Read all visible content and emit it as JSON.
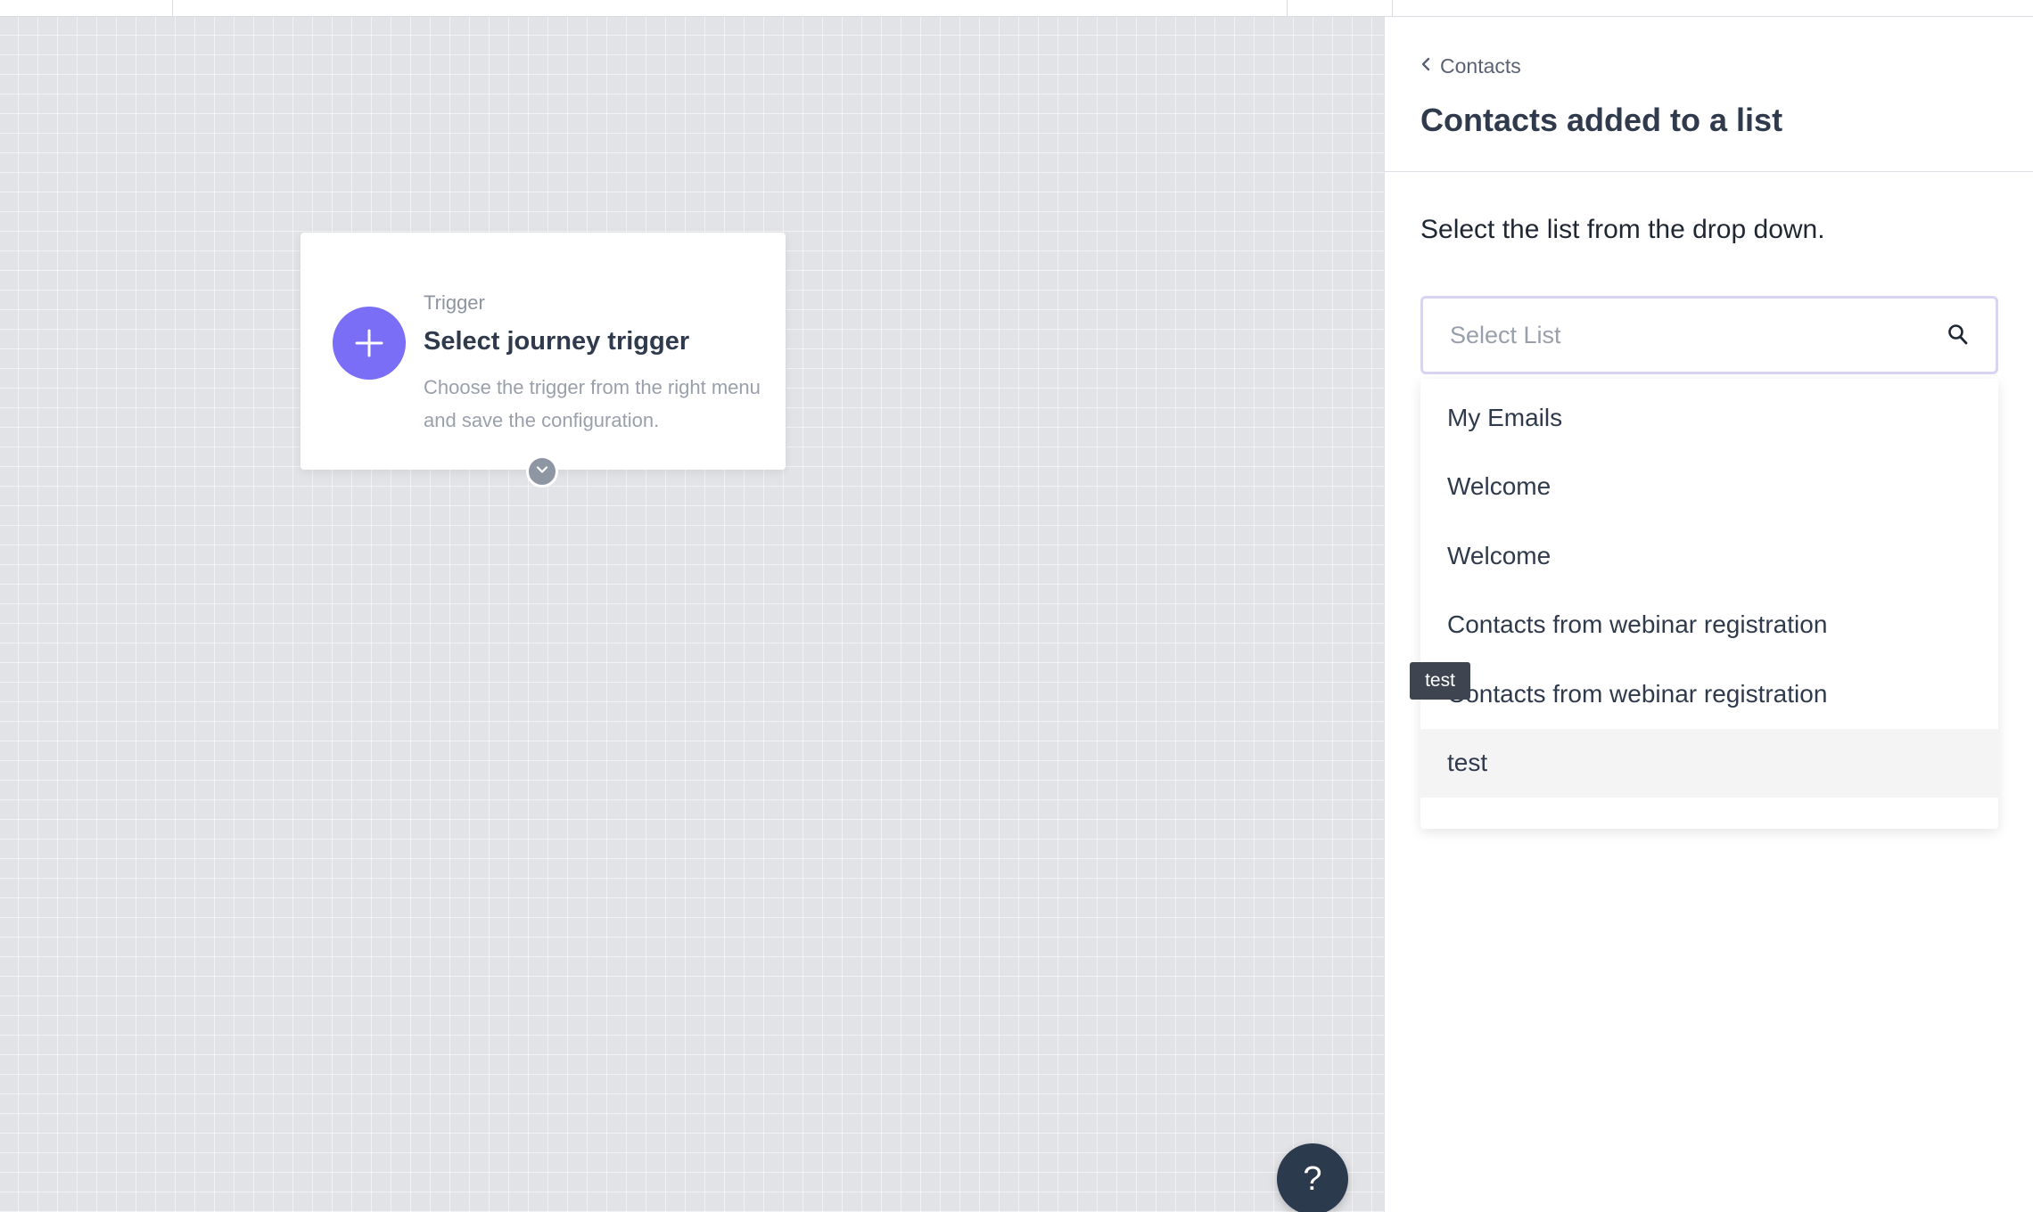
{
  "canvas": {
    "trigger_card": {
      "kicker": "Trigger",
      "title": "Select journey trigger",
      "description": "Choose the trigger from the right menu and save the configuration."
    },
    "help_button_label": "?"
  },
  "panel": {
    "breadcrumb": "Contacts",
    "title": "Contacts added to a list",
    "instruction": "Select the list from the drop down.",
    "select": {
      "placeholder": "Select List",
      "value": ""
    },
    "dropdown_items": [
      "My Emails",
      "Welcome",
      "Welcome",
      "Contacts from webinar registration",
      "Contacts from webinar registration",
      "test"
    ],
    "highlighted_item": "test"
  },
  "tooltip": {
    "text": "test"
  },
  "colors": {
    "accent": "#7b6ef6",
    "help_button": "#2c3a4e",
    "canvas_bg": "#e2e3e7",
    "tooltip_bg": "#3f4451"
  },
  "icons": {
    "breadcrumb_back": "chevron-left-icon",
    "trigger": "plus-icon",
    "expand": "chevron-down-icon",
    "search": "search-icon"
  }
}
